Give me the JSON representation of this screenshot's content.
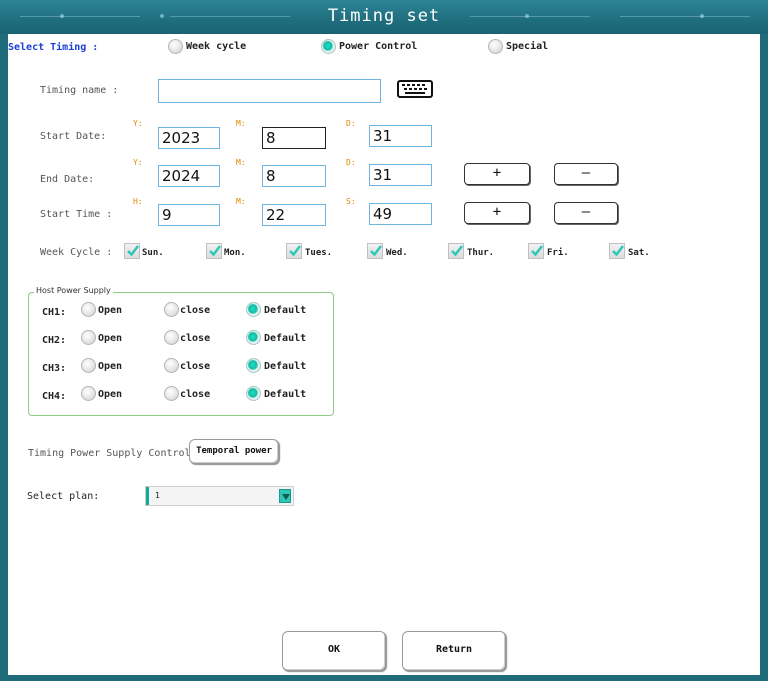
{
  "window": {
    "title": "Timing set"
  },
  "select_timing": {
    "label": "Select Timing :",
    "options": [
      {
        "label": "Week cycle",
        "selected": false
      },
      {
        "label": "Power Control",
        "selected": true
      },
      {
        "label": "Special",
        "selected": false
      }
    ]
  },
  "timing_name": {
    "label": "Timing name :",
    "value": ""
  },
  "start_date": {
    "label": "Start Date:",
    "y_tag": "Y:",
    "m_tag": "M:",
    "d_tag": "D:",
    "year": "2023",
    "month": "8",
    "day": "31"
  },
  "end_date": {
    "label": "End Date:",
    "y_tag": "Y:",
    "m_tag": "M:",
    "d_tag": "D:",
    "year": "2024",
    "month": "8",
    "day": "31"
  },
  "start_time": {
    "label": "Start Time  :",
    "h_tag": "H:",
    "m_tag": "M:",
    "s_tag": "S:",
    "hour": "9",
    "minute": "22",
    "second": "49"
  },
  "stepper": {
    "plus": "+",
    "minus": "—"
  },
  "week_cycle": {
    "label": "Week Cycle  :",
    "days": [
      {
        "label": "Sun.",
        "checked": true
      },
      {
        "label": "Mon.",
        "checked": true
      },
      {
        "label": "Tues.",
        "checked": true
      },
      {
        "label": "Wed.",
        "checked": true
      },
      {
        "label": "Thur.",
        "checked": true
      },
      {
        "label": "Fri.",
        "checked": true
      },
      {
        "label": "Sat.",
        "checked": true
      }
    ]
  },
  "host_power": {
    "title": "Host Power Supply",
    "channels": [
      {
        "label": "CH1:",
        "open": "Open",
        "close": "close",
        "default": "Default",
        "selected": "default"
      },
      {
        "label": "CH2:",
        "open": "Open",
        "close": "close",
        "default": "Default",
        "selected": "default"
      },
      {
        "label": "CH3:",
        "open": "Open",
        "close": "close",
        "default": "Default",
        "selected": "default"
      },
      {
        "label": "CH4:",
        "open": "Open",
        "close": "close",
        "default": "Default",
        "selected": "default"
      }
    ]
  },
  "timing_power": {
    "label": "Timing Power Supply Control",
    "button": "Temporal power"
  },
  "select_plan": {
    "label": "Select  plan:",
    "value": "1"
  },
  "footer": {
    "ok": "OK",
    "return": "Return"
  },
  "colors": {
    "title_bar": "#1f6e7e",
    "radio_on": "#14b9a5",
    "check": "#2fc7b5",
    "group_border": "#8ecb85",
    "label_blue": "#1a3fd6"
  },
  "icons": {
    "keyboard": "keyboard-icon",
    "checkmark": "checkmark-icon",
    "dropdown": "chevron-down-icon"
  }
}
